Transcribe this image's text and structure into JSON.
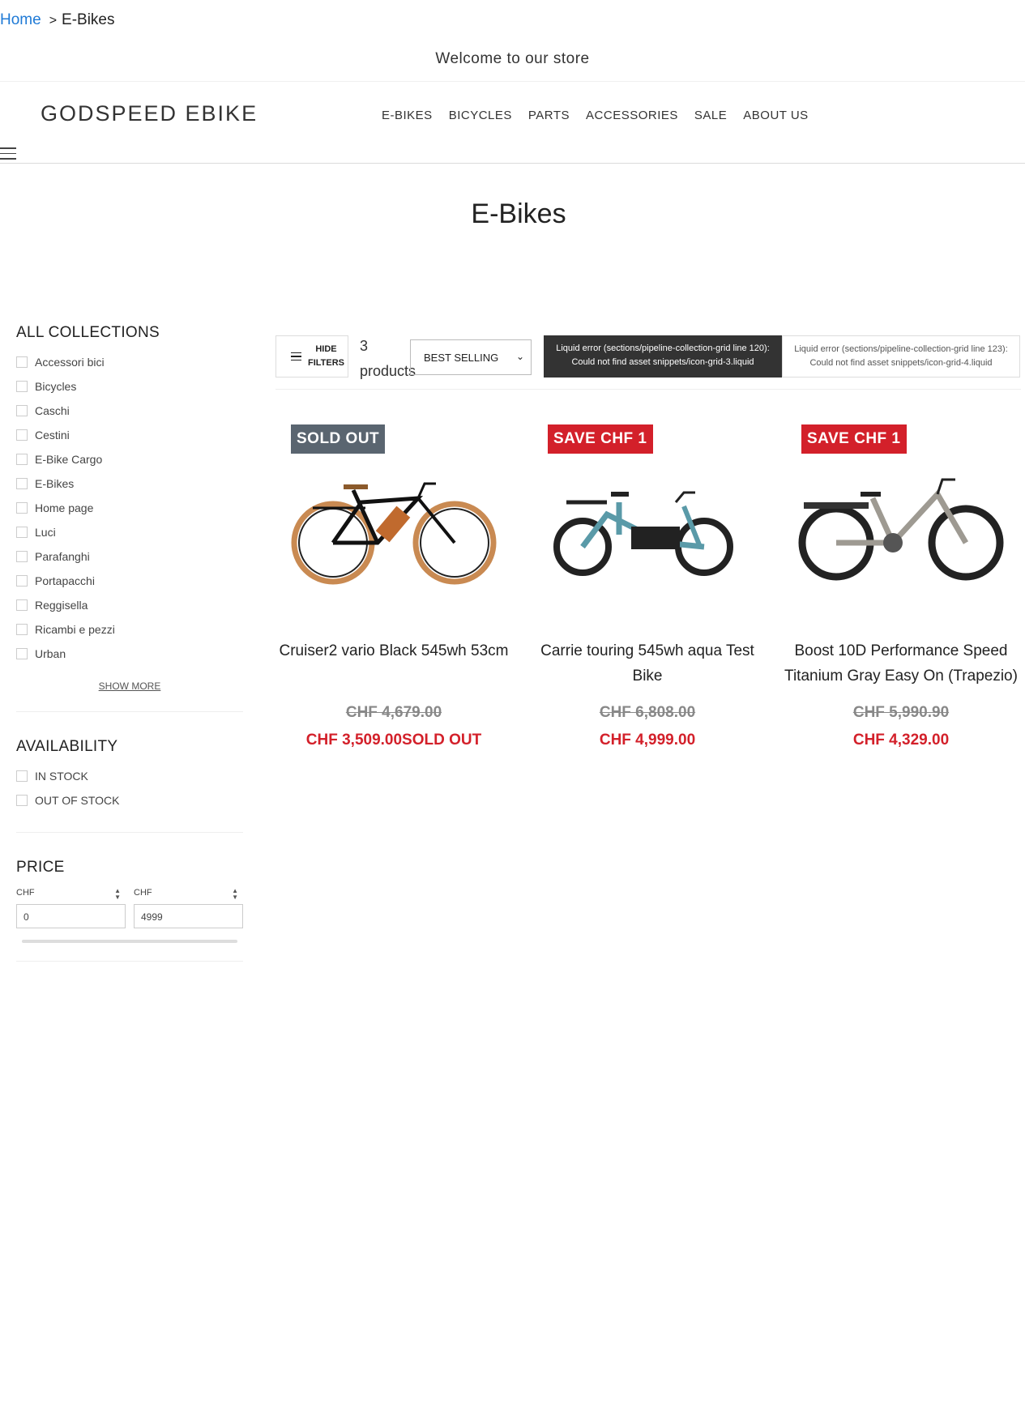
{
  "breadcrumb": {
    "home": "Home",
    "separator": ">",
    "current": "E-Bikes"
  },
  "announcement": "Welcome to our store",
  "header": {
    "logo": "GODSPEED EBIKE",
    "nav": [
      "E-BIKES",
      "BICYCLES",
      "PARTS",
      "ACCESSORIES",
      "SALE",
      "ABOUT US"
    ],
    "menu_icon": "hamburger-icon"
  },
  "page_title": "E-Bikes",
  "filters": {
    "collections": {
      "title": "ALL COLLECTIONS",
      "items": [
        "Accessori bici",
        "Bicycles",
        "Caschi",
        "Cestini",
        "E-Bike Cargo",
        "E-Bikes",
        "Home page",
        "Luci",
        "Parafanghi",
        "Portapacchi",
        "Reggisella",
        "Ricambi e pezzi",
        "Urban"
      ],
      "show_more": "SHOW MORE"
    },
    "availability": {
      "title": "AVAILABILITY",
      "items": [
        "IN STOCK",
        "OUT OF STOCK"
      ]
    },
    "price": {
      "title": "PRICE",
      "currency": "CHF",
      "min_value": "0",
      "max_value": "4999"
    }
  },
  "toolbar": {
    "hide_filters_line1": "HIDE",
    "hide_filters_line2": "FILTERS",
    "count_number": "3",
    "count_label": "products",
    "sort_selected": "BEST SELLING",
    "error_grid_3": "Liquid error (sections/pipeline-collection-grid line 120): Could not find asset snippets/icon-grid-3.liquid",
    "error_grid_4": "Liquid error (sections/pipeline-collection-grid line 123): Could not find asset snippets/icon-grid-4.liquid"
  },
  "products": [
    {
      "badge": "SOLD OUT",
      "title": "Cruiser2 vario Black 545wh 53cm",
      "compare_price": "CHF 4,679.00",
      "price": "CHF 3,509.00SOLD OUT"
    },
    {
      "badge": "SAVE CHF 1",
      "title": "Carrie touring 545wh aqua Test Bike",
      "compare_price": "CHF 6,808.00",
      "price": "CHF 4,999.00"
    },
    {
      "badge": "SAVE CHF 1",
      "title": "Boost 10D Performance Speed Titanium Gray Easy On (Trapezio)",
      "compare_price": "CHF 5,990.90",
      "price": "CHF 4,329.00"
    }
  ],
  "colors": {
    "link": "#1f7ad6",
    "sale_red": "#d3202a",
    "sold_out_badge": "#5a6570",
    "error_dark": "#333333"
  }
}
